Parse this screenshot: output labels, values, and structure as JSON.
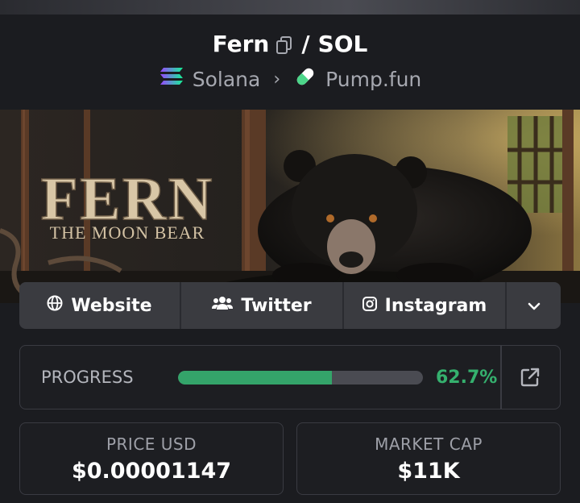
{
  "token": {
    "name": "Fern",
    "quote": "SOL",
    "separator": "/"
  },
  "chain": {
    "name": "Solana",
    "launchpad": "Pump.fun",
    "arrow": "›"
  },
  "banner": {
    "title": "FERN",
    "subtitle": "THE MOON BEAR"
  },
  "links": [
    {
      "label": "Website",
      "icon": "globe-icon"
    },
    {
      "label": "Twitter",
      "icon": "users-icon"
    },
    {
      "label": "Instagram",
      "icon": "instagram-icon"
    }
  ],
  "progress": {
    "label": "PROGRESS",
    "value_text": "62.7%",
    "fraction": 0.627,
    "color": "#34a46a"
  },
  "stats": {
    "price_label": "PRICE USD",
    "price_value": "$0.00001147",
    "cap_label": "MARKET CAP",
    "cap_value": "$11K"
  }
}
